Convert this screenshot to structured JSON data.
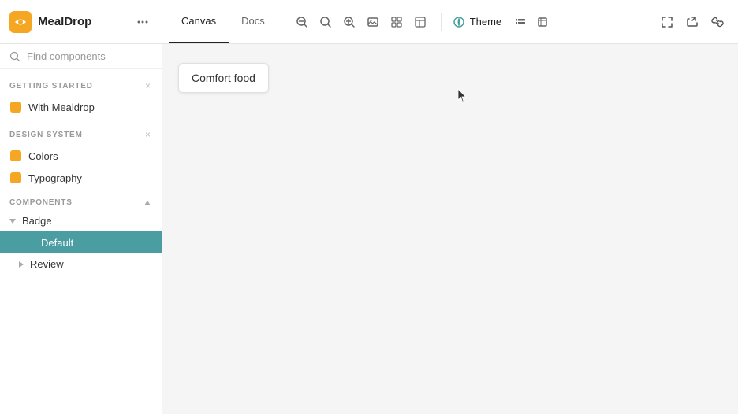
{
  "app": {
    "logo_text": "MealDrop",
    "logo_icon_color": "#f5a623"
  },
  "topbar": {
    "tabs": [
      {
        "id": "canvas",
        "label": "Canvas",
        "active": true
      },
      {
        "id": "docs",
        "label": "Docs",
        "active": false
      }
    ],
    "toolbar": {
      "zoom_out_title": "Zoom out",
      "zoom_reset_title": "Reset zoom",
      "zoom_in_title": "Zoom in",
      "image_title": "Image",
      "grid_title": "Grid",
      "table_title": "Table",
      "theme_label": "Theme",
      "layout_title": "Layout",
      "frame_title": "Frame"
    },
    "right_toolbar": {
      "fullscreen_title": "Fullscreen",
      "share_title": "Share",
      "link_title": "Copy link"
    }
  },
  "sidebar": {
    "search_placeholder": "Find components",
    "search_shortcut": "/",
    "sections": [
      {
        "id": "getting-started",
        "title": "GETTING STARTED",
        "items": [
          {
            "id": "with-mealdrop",
            "label": "With Mealdrop",
            "icon_type": "orange-square"
          }
        ]
      },
      {
        "id": "design-system",
        "title": "DESIGN SYSTEM",
        "items": [
          {
            "id": "colors",
            "label": "Colors",
            "icon_type": "orange-square"
          },
          {
            "id": "typography",
            "label": "Typography",
            "icon_type": "orange-square"
          }
        ]
      },
      {
        "id": "components",
        "title": "COMPONENTS",
        "items": [
          {
            "id": "badge",
            "label": "Badge",
            "expanded": true,
            "children": [
              {
                "id": "default",
                "label": "Default",
                "active": true,
                "icon_type": "teal-square"
              },
              {
                "id": "review",
                "label": "Review",
                "active": false
              }
            ]
          }
        ]
      }
    ]
  },
  "canvas": {
    "comfort_food_label": "Comfort food"
  }
}
